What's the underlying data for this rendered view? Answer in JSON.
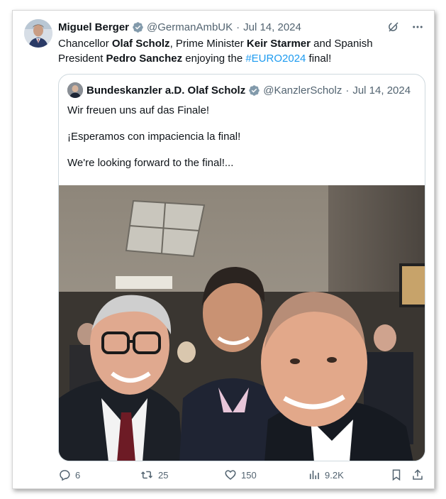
{
  "tweet": {
    "author_name": "Miguel Berger",
    "handle": "@GermanAmbUK",
    "separator": "·",
    "date": "Jul 14, 2024",
    "text": {
      "p1": "Chancellor ",
      "b1": "Olaf Scholz",
      "p2": ", Prime Minister ",
      "b2": "Keir Starmer",
      "p3": " and Spanish President ",
      "b3": "Pedro Sanchez",
      "p4": " enjoying the ",
      "hashtag": "#EURO2024",
      "p5": " final!"
    }
  },
  "quoted": {
    "author_name": "Bundeskanzler a.D. Olaf Scholz",
    "handle": "@KanzlerScholz",
    "separator": "·",
    "date": "Jul 14, 2024",
    "lines": [
      "Wir freuen uns auf das Finale!",
      "¡Esperamos con impaciencia la final!",
      "We're looking forward to the final!..."
    ]
  },
  "actions": {
    "replies": "6",
    "reposts": "25",
    "likes": "150",
    "views": "9.2K"
  },
  "colors": {
    "text": "#0f1419",
    "muted": "#536471",
    "link": "#1d9bf0",
    "verified": "#829aab",
    "border": "#cfd9de"
  },
  "icons": [
    "grok-icon",
    "more-icon",
    "verified-badge-icon",
    "reply-icon",
    "repost-icon",
    "like-icon",
    "views-icon",
    "bookmark-icon",
    "share-icon"
  ]
}
